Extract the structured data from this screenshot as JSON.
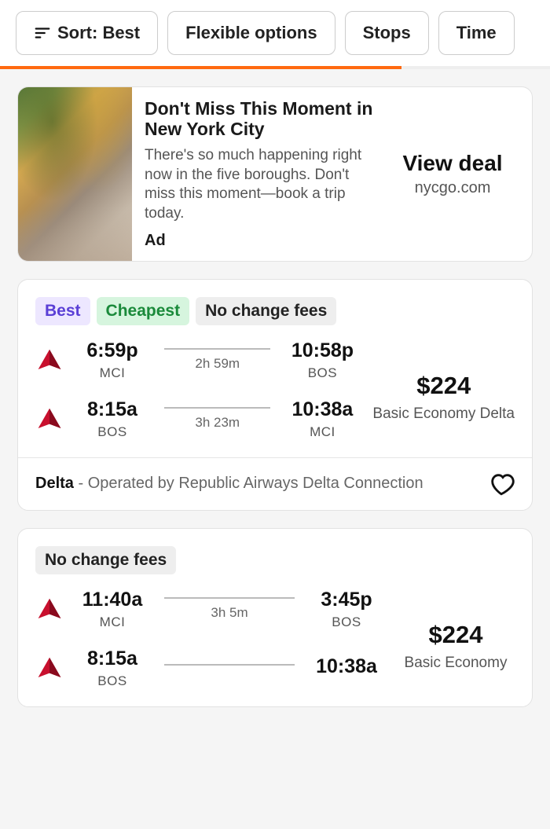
{
  "filters": {
    "sort": "Sort: Best",
    "flexible": "Flexible options",
    "stops": "Stops",
    "time": "Time"
  },
  "ad": {
    "title": "Don't Miss This Moment in New York City",
    "desc": "There's so much happening right now in the five boroughs. Don't miss this moment—book a trip today.",
    "label": "Ad",
    "cta": "View deal",
    "domain": "nycgo.com"
  },
  "badges": {
    "best": "Best",
    "cheapest": "Cheapest",
    "nochange": "No change fees"
  },
  "results": [
    {
      "badges": [
        "best",
        "cheapest",
        "nochange"
      ],
      "legs": [
        {
          "dep_time": "6:59p",
          "dep_code": "MCI",
          "duration": "2h 59m",
          "arr_time": "10:58p",
          "arr_code": "BOS"
        },
        {
          "dep_time": "8:15a",
          "dep_code": "BOS",
          "duration": "3h 23m",
          "arr_time": "10:38a",
          "arr_code": "MCI"
        }
      ],
      "price": "$224",
      "fare": "Basic Economy Delta",
      "carrier": "Delta",
      "operated": "Operated by Republic Airways Delta Connection"
    },
    {
      "badges": [
        "nochange"
      ],
      "legs": [
        {
          "dep_time": "11:40a",
          "dep_code": "MCI",
          "duration": "3h 5m",
          "arr_time": "3:45p",
          "arr_code": "BOS"
        },
        {
          "dep_time": "8:15a",
          "dep_code": "BOS",
          "duration": "",
          "arr_time": "10:38a",
          "arr_code": ""
        }
      ],
      "price": "$224",
      "fare": "Basic Economy"
    }
  ]
}
